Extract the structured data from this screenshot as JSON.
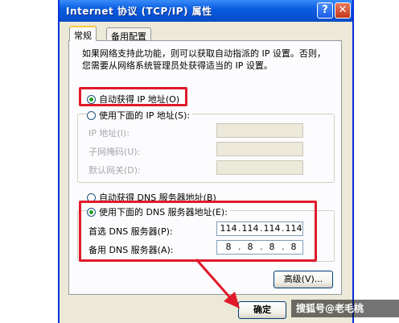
{
  "window": {
    "title": "Internet 协议 (TCP/IP) 属性",
    "help_label": "?",
    "close_label": "✕"
  },
  "tabs": [
    {
      "label": "常规"
    },
    {
      "label": "备用配置"
    }
  ],
  "description": {
    "line1": "如果网络支持此功能，则可以获取自动指派的 IP 设置。否则，",
    "line2": "您需要从网络系统管理员处获得适当的 IP 设置。"
  },
  "ip": {
    "auto_label": "自动获得 IP 地址(O)",
    "manual_label": "使用下面的 IP 地址(S):",
    "address_label": "IP 地址(I):",
    "subnet_label": "子网掩码(U):",
    "gateway_label": "默认网关(D):"
  },
  "dns": {
    "auto_label": "自动获得 DNS 服务器地址(B)",
    "manual_label": "使用下面的 DNS 服务器地址(E):",
    "preferred_label": "首选 DNS 服务器(P):",
    "alternate_label": "备用 DNS 服务器(A):",
    "preferred_value": [
      "114",
      "114",
      "114",
      "114"
    ],
    "alternate_value": [
      "8",
      "8",
      "8",
      "8"
    ]
  },
  "buttons": {
    "advanced_label": "高级(V)...",
    "ok_label": "确定"
  },
  "watermark": "搜狐号@老毛桃",
  "colors": {
    "highlight": "#e01a2a",
    "titlebar": "#0a5ee0",
    "radio_selected": "#21a121"
  }
}
